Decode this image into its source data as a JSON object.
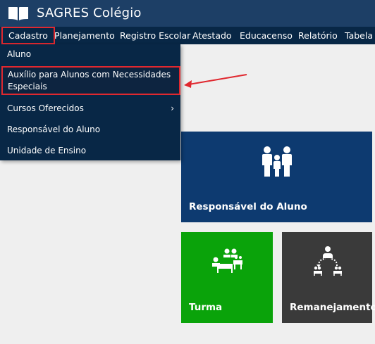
{
  "app": {
    "title": "SAGRES Colégio",
    "logo_icon": "book-icon"
  },
  "menu": {
    "items": [
      "Cadastro",
      "Planejamento",
      "Registro Escolar",
      "Atestado",
      "Educacenso",
      "Relatório",
      "Tabela"
    ],
    "active": "Cadastro"
  },
  "dropdown": {
    "items": [
      {
        "label": "Aluno"
      },
      {
        "label_line1": "Auxílio para Alunos com Necessidades",
        "label_line2": "Especiais",
        "highlighted": true
      },
      {
        "label": "Cursos Oferecidos",
        "chevron": "›"
      },
      {
        "label": "Responsável do Aluno"
      },
      {
        "label": "Unidade de Ensino"
      }
    ]
  },
  "tiles": [
    {
      "label": "Responsável do Aluno",
      "icon": "family-icon",
      "color": "#0d3a70"
    },
    {
      "label": "Turma",
      "icon": "classroom-icon",
      "color": "#0aa30a"
    },
    {
      "label": "Remanejamento",
      "icon": "transfer-icon",
      "color": "#3a3a3a"
    }
  ],
  "colors": {
    "titlebar": "#1d3f66",
    "menubar": "#082746",
    "highlight_border": "#e0282f",
    "annotation_arrow": "#e0282f",
    "background": "#efefef"
  }
}
